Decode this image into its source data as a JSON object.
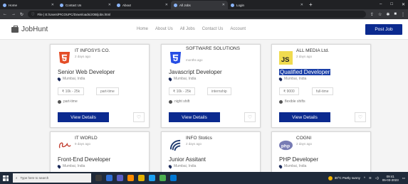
{
  "browser": {
    "tabs": [
      {
        "label": "Home",
        "active": false
      },
      {
        "label": "Contact Us",
        "active": false
      },
      {
        "label": "About",
        "active": false
      },
      {
        "label": "All Jobs",
        "active": true
      },
      {
        "label": "Login",
        "active": false
      }
    ],
    "url": "File | E:/Users/PICOUPC/Downloads/JOB/jobs.html",
    "icons": [
      "back-icon",
      "forward-icon",
      "reload-icon",
      "share-icon",
      "star-icon",
      "extensions-icon",
      "profile-icon",
      "menu-icon"
    ]
  },
  "site": {
    "brand": "JobHunt",
    "nav": [
      "Home",
      "About Us",
      "All Jobs",
      "Contact Us",
      "Account"
    ],
    "post_job": "Post Job"
  },
  "colors": {
    "accent": "#0b2a8f",
    "html5": "#e44d26",
    "css3": "#264de4",
    "js": "#f0db4f",
    "php": "#777bb4"
  },
  "jobs": [
    {
      "company": "IT INFOSYS CO.",
      "time": "2 days ago",
      "title": "Senior Web Developer",
      "location": "Mumbai, India",
      "salary": "₹ 10k - 25k",
      "type": "part-time",
      "shift": "part-time",
      "view": "View Details",
      "logo": "html5-logo",
      "highlighted": false
    },
    {
      "company": "SOFTWARE SOLUTIONS",
      "time": "months ago",
      "title": "Javascript Developer",
      "location": "Mumbai, India",
      "salary": "₹ 10k - 25k",
      "type": "internship",
      "shift": "night shift",
      "view": "View Details",
      "logo": "css3-logo",
      "highlighted": false
    },
    {
      "company": "ALL MEDIA Ltd.",
      "time": "2 days ago",
      "title": "Qualified Developer",
      "location": "Mumbai, India",
      "salary": "₹ 9000",
      "type": "full-time",
      "shift": "flexible shifts",
      "view": "View Details",
      "logo": "js-logo",
      "highlighted": true
    },
    {
      "company": "IT WORLD",
      "time": "9 days ago",
      "title": "Front-End Developer",
      "location": "Mumbai, India",
      "logo": "script-logo"
    },
    {
      "company": "INFO Stotics",
      "time": "2 days ago",
      "title": "Junior Assitant",
      "location": "Mumbai, India",
      "logo": "wave-logo"
    },
    {
      "company": "COGNI",
      "time": "2 days ago",
      "title": "PHP Developer",
      "location": "Mumbai, India",
      "logo": "php-logo"
    }
  ],
  "taskbar": {
    "search_placeholder": "Type here to search",
    "weather": "30°C Partly sunny",
    "time": "09:41",
    "date": "05-03-2023"
  }
}
